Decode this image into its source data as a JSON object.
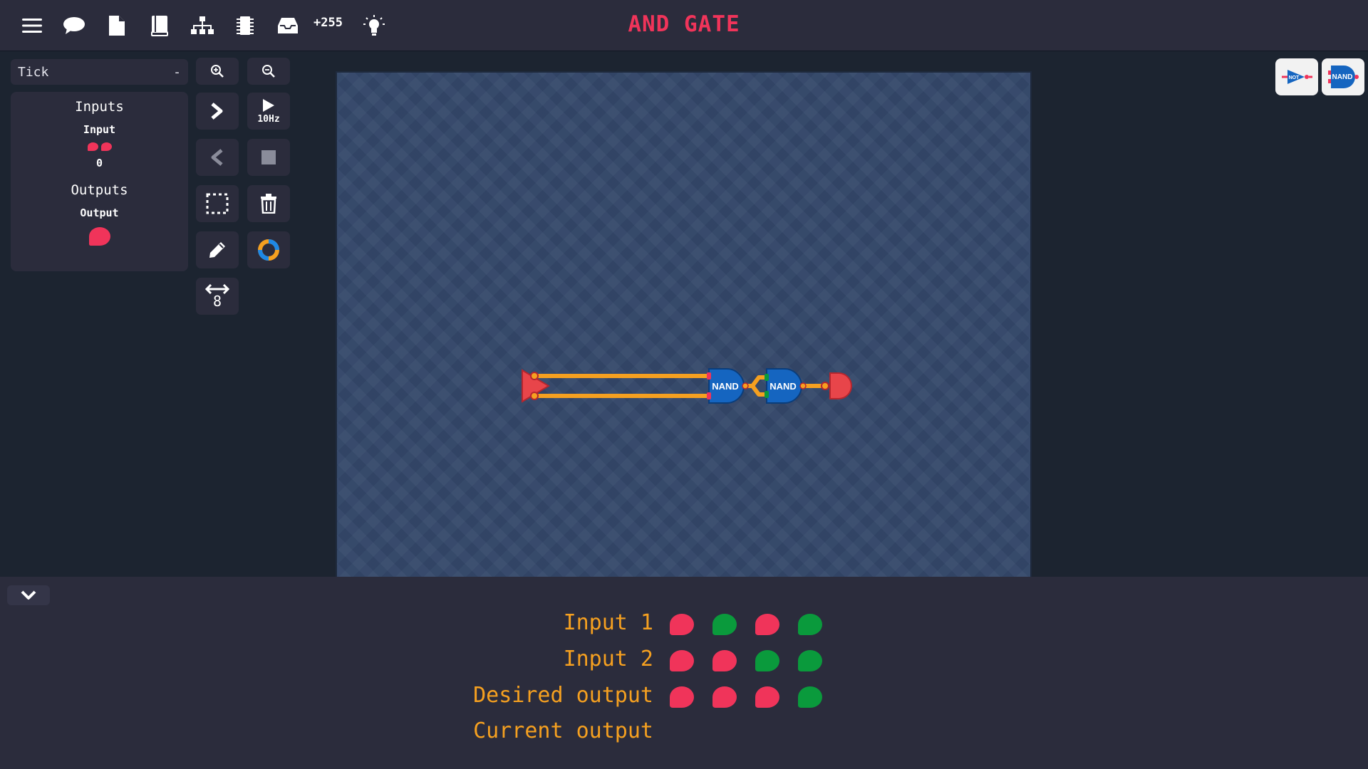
{
  "topbar": {
    "icons": [
      "menu-icon",
      "chat-icon",
      "file-icon",
      "book-icon",
      "hierarchy-icon",
      "chip-icon",
      "inbox-icon",
      "lightbulb-icon"
    ],
    "count": "+255",
    "title": "AND GATE"
  },
  "tick_select": {
    "value": "Tick",
    "arrow": "-"
  },
  "io_panel": {
    "inputs_heading": "Inputs",
    "input_name": "Input",
    "input_value": "0",
    "outputs_heading": "Outputs",
    "output_name": "Output"
  },
  "tools": {
    "zoom_in": "zoom-in-icon",
    "zoom_out": "zoom-out-icon",
    "step_forward": "chevron-right-icon",
    "play_label": "10Hz",
    "step_back": "chevron-left-icon",
    "stop": "stop-icon",
    "select": "selection-icon",
    "delete": "trash-icon",
    "pencil": "pencil-icon",
    "color": "color-ring-icon",
    "width_value": "8"
  },
  "circuit": {
    "gate1_label": "NAND",
    "gate2_label": "NAND"
  },
  "palette": {
    "not_label": "NOT",
    "nand_label": "NAND"
  },
  "truth_table": {
    "rows": [
      {
        "label": "Input 1",
        "values": [
          0,
          1,
          0,
          1
        ]
      },
      {
        "label": "Input 2",
        "values": [
          0,
          0,
          1,
          1
        ]
      },
      {
        "label": "Desired output",
        "values": [
          0,
          0,
          0,
          1
        ]
      },
      {
        "label": "Current output",
        "values": []
      }
    ]
  },
  "colors": {
    "accent_red": "#f0345a",
    "on_green": "#0a9a3c",
    "wire_orange": "#f5a020",
    "gate_blue": "#1565c0",
    "label_orange": "#f5a020"
  }
}
